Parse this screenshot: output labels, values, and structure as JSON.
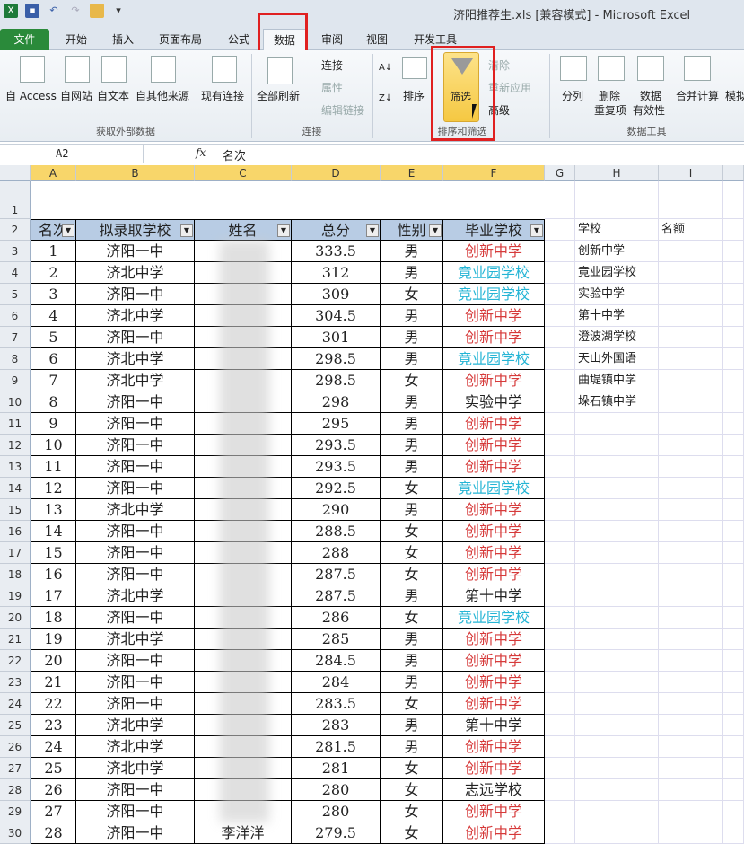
{
  "window": {
    "title": "济阳推荐生.xls  [兼容模式]  -  Microsoft Excel"
  },
  "tabs": [
    "文件",
    "开始",
    "插入",
    "页面布局",
    "公式",
    "数据",
    "审阅",
    "视图",
    "开发工具"
  ],
  "ribbon": {
    "get_external": {
      "items": [
        "自 Access",
        "自网站",
        "自文本",
        "自其他来源",
        "现有连接"
      ],
      "group": "获取外部数据"
    },
    "connections": {
      "refresh": "全部刷新",
      "items": [
        "连接",
        "属性",
        "编辑链接"
      ],
      "group": "连接"
    },
    "sort_filter": {
      "sort": "排序",
      "filter": "筛选",
      "clear": "清除",
      "reapply": "重新应用",
      "advanced": "高级",
      "group": "排序和筛选"
    },
    "data_tools": {
      "split": "分列",
      "remove_dup": [
        "删除",
        "重复项"
      ],
      "validation": [
        "数据",
        "有效性"
      ],
      "consolidate": "合并计算",
      "whatif": "模拟",
      "group": "数据工具"
    }
  },
  "formula_bar": {
    "name_box": "A2",
    "fx": "fx",
    "value": "名次"
  },
  "columns": [
    "A",
    "B",
    "C",
    "D",
    "E",
    "F",
    "G",
    "H",
    "I"
  ],
  "sheet": {
    "title": "济阳区推荐生录取统计表",
    "headers": [
      "名次",
      "拟录取学校",
      "姓名",
      "总分",
      "性别",
      "毕业学校"
    ],
    "rows": [
      [
        "1",
        "济阳一中",
        "",
        "333.5",
        "男",
        "创新中学"
      ],
      [
        "2",
        "济北中学",
        "",
        "312",
        "男",
        "竟业园学校"
      ],
      [
        "3",
        "济阳一中",
        "",
        "309",
        "女",
        "竟业园学校"
      ],
      [
        "4",
        "济北中学",
        "",
        "304.5",
        "男",
        "创新中学"
      ],
      [
        "5",
        "济阳一中",
        "",
        "301",
        "男",
        "创新中学"
      ],
      [
        "6",
        "济北中学",
        "",
        "298.5",
        "男",
        "竟业园学校"
      ],
      [
        "7",
        "济北中学",
        "",
        "298.5",
        "女",
        "创新中学"
      ],
      [
        "8",
        "济阳一中",
        "",
        "298",
        "男",
        "实验中学"
      ],
      [
        "9",
        "济阳一中",
        "",
        "295",
        "男",
        "创新中学"
      ],
      [
        "10",
        "济阳一中",
        "",
        "293.5",
        "男",
        "创新中学"
      ],
      [
        "11",
        "济阳一中",
        "",
        "293.5",
        "男",
        "创新中学"
      ],
      [
        "12",
        "济阳一中",
        "",
        "292.5",
        "女",
        "竟业园学校"
      ],
      [
        "13",
        "济北中学",
        "",
        "290",
        "男",
        "创新中学"
      ],
      [
        "14",
        "济阳一中",
        "",
        "288.5",
        "女",
        "创新中学"
      ],
      [
        "15",
        "济阳一中",
        "",
        "288",
        "女",
        "创新中学"
      ],
      [
        "16",
        "济阳一中",
        "",
        "287.5",
        "女",
        "创新中学"
      ],
      [
        "17",
        "济北中学",
        "",
        "287.5",
        "男",
        "第十中学"
      ],
      [
        "18",
        "济阳一中",
        "",
        "286",
        "女",
        "竟业园学校"
      ],
      [
        "19",
        "济北中学",
        "",
        "285",
        "男",
        "创新中学"
      ],
      [
        "20",
        "济阳一中",
        "",
        "284.5",
        "男",
        "创新中学"
      ],
      [
        "21",
        "济阳一中",
        "",
        "284",
        "男",
        "创新中学"
      ],
      [
        "22",
        "济阳一中",
        "",
        "283.5",
        "女",
        "创新中学"
      ],
      [
        "23",
        "济北中学",
        "",
        "283",
        "男",
        "第十中学"
      ],
      [
        "24",
        "济北中学",
        "",
        "281.5",
        "男",
        "创新中学"
      ],
      [
        "25",
        "济北中学",
        "",
        "281",
        "女",
        "创新中学"
      ],
      [
        "26",
        "济阳一中",
        "",
        "280",
        "女",
        "志远学校"
      ],
      [
        "27",
        "济阳一中",
        "",
        "280",
        "女",
        "创新中学"
      ],
      [
        "28",
        "济阳一中",
        "李洋洋",
        "279.5",
        "女",
        "创新中学"
      ]
    ],
    "side_headers": [
      "学校",
      "名额"
    ],
    "side_list": [
      "创新中学",
      "竟业园学校",
      "实验中学",
      "第十中学",
      "澄波湖学校",
      "天山外国语",
      "曲堤镇中学",
      "垛石镇中学"
    ]
  },
  "colors": {
    "创新中学": "#d63a3a",
    "竟业园学校": "#25b5d5",
    "default": "#222222"
  }
}
